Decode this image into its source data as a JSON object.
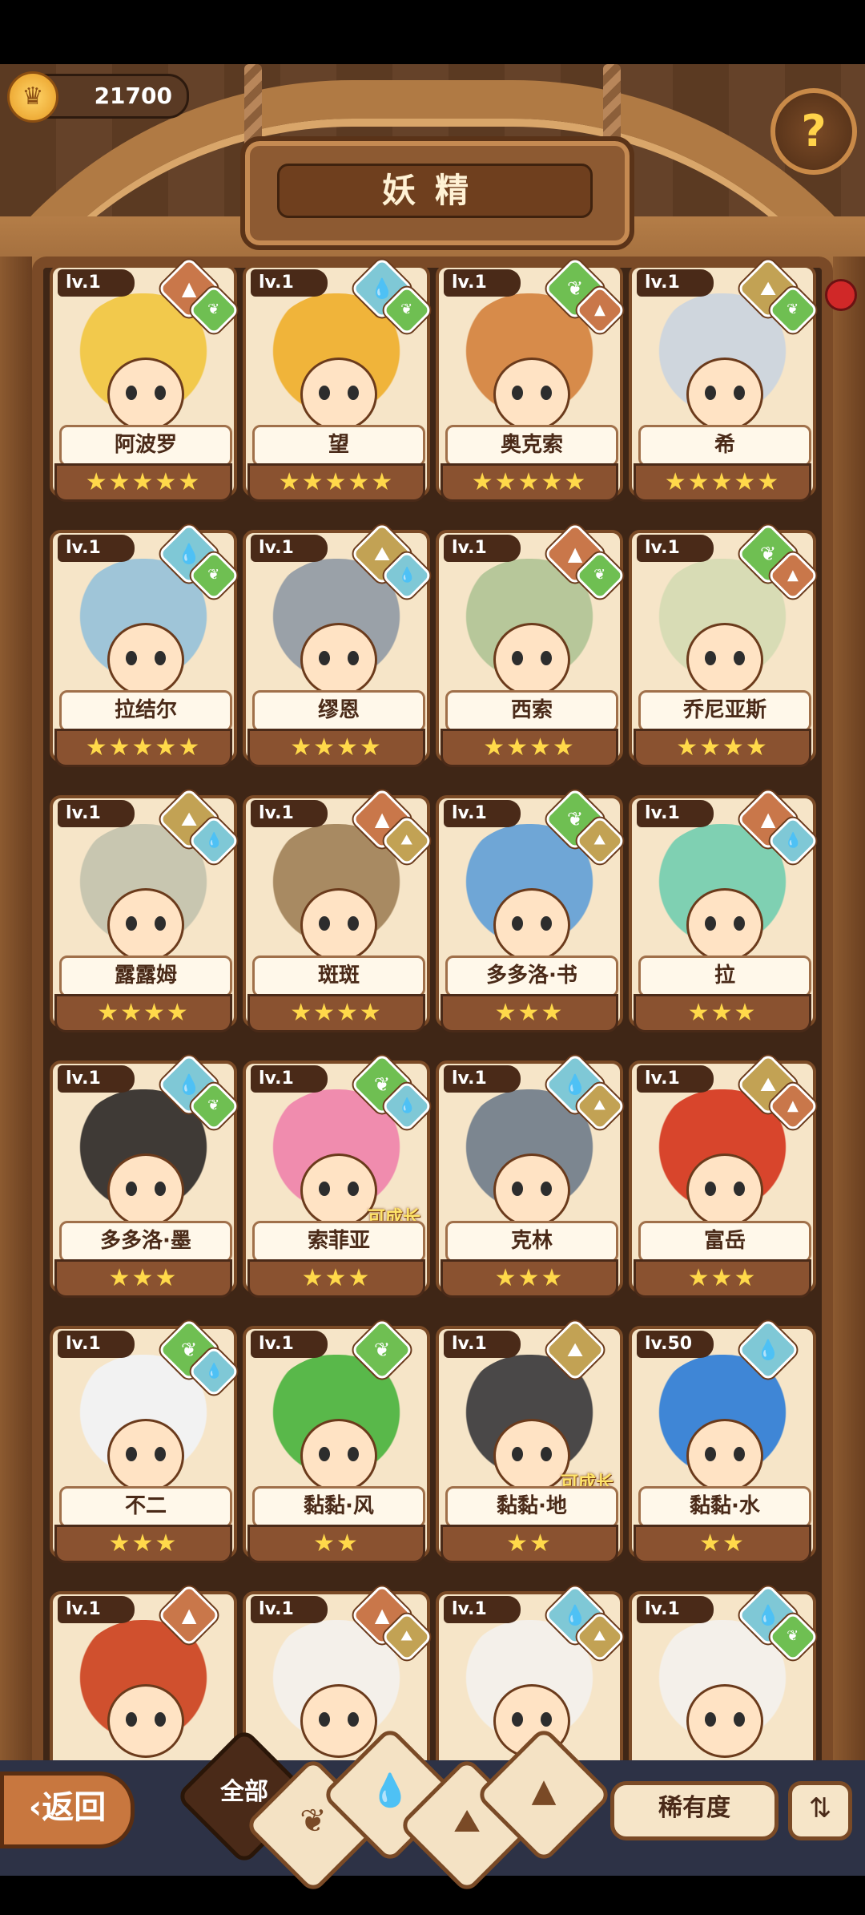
{
  "hud": {
    "coins": "21700",
    "help_label": "?"
  },
  "title": "妖精",
  "cards": [
    {
      "name": "阿波罗",
      "level": "lv.1",
      "stars": "★★★★★",
      "color": "#f2c94c",
      "e1": "fire",
      "e2": "leaf"
    },
    {
      "name": "望",
      "level": "lv.1",
      "stars": "★★★★★",
      "color": "#f0b43a",
      "e1": "water",
      "e2": "leaf"
    },
    {
      "name": "奥克索",
      "level": "lv.1",
      "stars": "★★★★★",
      "color": "#d78b4a",
      "e1": "leaf",
      "e2": "fire"
    },
    {
      "name": "希",
      "level": "lv.1",
      "stars": "★★★★★",
      "color": "#cfd6dd",
      "e1": "earth",
      "e2": "leaf"
    },
    {
      "name": "拉结尔",
      "level": "lv.1",
      "stars": "★★★★★",
      "color": "#9fc5d8",
      "e1": "water",
      "e2": "leaf"
    },
    {
      "name": "缪恩",
      "level": "lv.1",
      "stars": "★★★★",
      "color": "#9aa1a8",
      "e1": "earth",
      "e2": "water"
    },
    {
      "name": "西索",
      "level": "lv.1",
      "stars": "★★★★",
      "color": "#b7c79a",
      "e1": "fire",
      "e2": "leaf"
    },
    {
      "name": "乔尼亚斯",
      "level": "lv.1",
      "stars": "★★★★",
      "color": "#d8dcb5",
      "e1": "leaf",
      "e2": "fire"
    },
    {
      "name": "露露姆",
      "level": "lv.1",
      "stars": "★★★★",
      "color": "#c8c6b0",
      "e1": "earth",
      "e2": "water"
    },
    {
      "name": "斑斑",
      "level": "lv.1",
      "stars": "★★★★",
      "color": "#a88a62",
      "e1": "fire",
      "e2": "earth"
    },
    {
      "name": "多多洛·书",
      "level": "lv.1",
      "stars": "★★★",
      "color": "#6fa6d6",
      "e1": "leaf",
      "e2": "earth"
    },
    {
      "name": "拉",
      "level": "lv.1",
      "stars": "★★★",
      "color": "#7fd0b2",
      "e1": "fire",
      "e2": "water"
    },
    {
      "name": "多多洛·墨",
      "level": "lv.1",
      "stars": "★★★",
      "color": "#3f3a36",
      "e1": "water",
      "e2": "leaf"
    },
    {
      "name": "索菲亚",
      "level": "lv.1",
      "stars": "★★★",
      "color": "#f08cae",
      "e1": "leaf",
      "e2": "water",
      "tag": "可成长"
    },
    {
      "name": "克林",
      "level": "lv.1",
      "stars": "★★★",
      "color": "#7c8690",
      "e1": "water",
      "e2": "earth"
    },
    {
      "name": "富岳",
      "level": "lv.1",
      "stars": "★★★",
      "color": "#d8452c",
      "e1": "earth",
      "e2": "fire"
    },
    {
      "name": "不二",
      "level": "lv.1",
      "stars": "★★★",
      "color": "#f2f2f2",
      "e1": "leaf",
      "e2": "water"
    },
    {
      "name": "黏黏·风",
      "level": "lv.1",
      "stars": "★★",
      "color": "#59b84a",
      "e1": "leaf",
      "e2": ""
    },
    {
      "name": "黏黏·地",
      "level": "lv.1",
      "stars": "★★",
      "color": "#4a4848",
      "e1": "earth",
      "e2": "",
      "tag": "可成长"
    },
    {
      "name": "黏黏·水",
      "level": "lv.50",
      "stars": "★★",
      "color": "#3f86d6",
      "e1": "water",
      "e2": ""
    },
    {
      "name": "",
      "level": "lv.1",
      "stars": "",
      "color": "#d0502e",
      "e1": "fire",
      "e2": ""
    },
    {
      "name": "",
      "level": "lv.1",
      "stars": "",
      "color": "#f4f0ea",
      "e1": "fire",
      "e2": "earth"
    },
    {
      "name": "",
      "level": "lv.1",
      "stars": "",
      "color": "#f4f0ea",
      "e1": "water",
      "e2": "earth"
    },
    {
      "name": "",
      "level": "lv.1",
      "stars": "",
      "color": "#f4f0ea",
      "e1": "water",
      "e2": "leaf"
    }
  ],
  "bottom": {
    "back_label": "‹返回",
    "filter_all": "全部",
    "filter_icons": [
      "leaf-icon",
      "water-icon",
      "earth-icon",
      "mountain-icon"
    ],
    "rarity_label": "稀有度",
    "sort_icon": "⇅"
  }
}
